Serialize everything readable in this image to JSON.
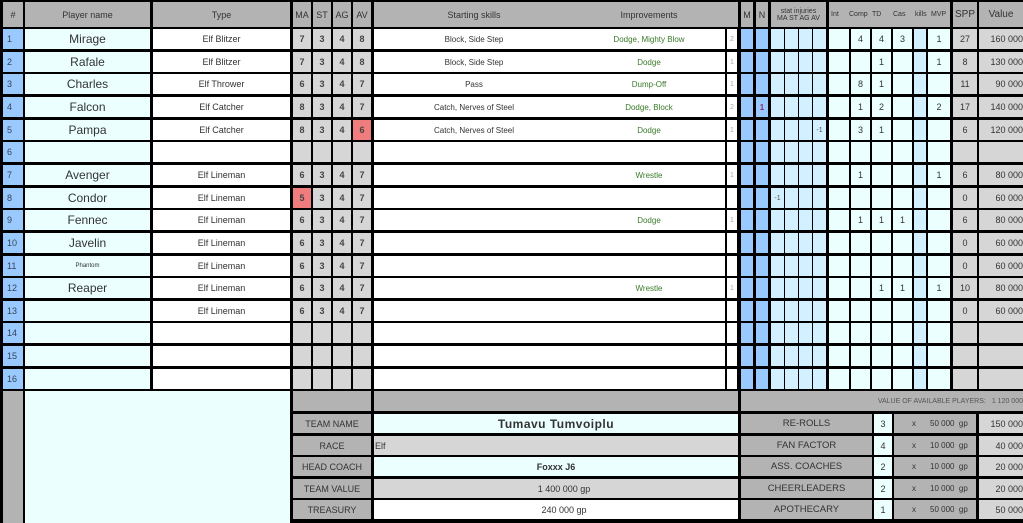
{
  "headers": {
    "num": "#",
    "player_name": "Player name",
    "type": "Type",
    "ma": "MA",
    "st": "ST",
    "ag": "AG",
    "av": "AV",
    "starting_skills": "Starting skills",
    "improvements": "Improvements",
    "m": "M",
    "n": "N",
    "stat_injuries_line1": "stat injuries",
    "stat_injuries_line2": "MA ST AG AV",
    "int": "Int",
    "comp": "Comp",
    "td": "TD",
    "cas": "Cas",
    "kills": "kills",
    "mvp": "MVP",
    "spp": "SPP",
    "value": "Value"
  },
  "players": [
    {
      "num": "1",
      "name": "Mirage",
      "type": "Elf Blitzer",
      "ma": "7",
      "st": "3",
      "ag": "4",
      "av": "8",
      "skills": "Block, Side Step",
      "improvements": "Dodge, Mighty Blow",
      "count": "2",
      "m": "",
      "n": "",
      "inj_ma": "",
      "inj_st": "",
      "inj_ag": "",
      "inj_av": "",
      "int": "",
      "comp": "4",
      "td": "4",
      "cas": "3",
      "kills": "",
      "mvp": "1",
      "spp": "27",
      "value": "160 000"
    },
    {
      "num": "2",
      "name": "Rafale",
      "type": "Elf Blitzer",
      "ma": "7",
      "st": "3",
      "ag": "4",
      "av": "8",
      "skills": "Block, Side Step",
      "improvements": "Dodge",
      "count": "1",
      "m": "",
      "n": "",
      "inj_ma": "",
      "inj_st": "",
      "inj_ag": "",
      "inj_av": "",
      "int": "",
      "comp": "",
      "td": "1",
      "cas": "",
      "kills": "",
      "mvp": "1",
      "spp": "8",
      "value": "130 000"
    },
    {
      "num": "3",
      "name": "Charles",
      "type": "Elf Thrower",
      "ma": "6",
      "st": "3",
      "ag": "4",
      "av": "7",
      "skills": "Pass",
      "improvements": "Dump-Off",
      "count": "1",
      "m": "",
      "n": "",
      "inj_ma": "",
      "inj_st": "",
      "inj_ag": "",
      "inj_av": "",
      "int": "",
      "comp": "8",
      "td": "1",
      "cas": "",
      "kills": "",
      "mvp": "",
      "spp": "11",
      "value": "90 000"
    },
    {
      "num": "4",
      "name": "Falcon",
      "type": "Elf Catcher",
      "ma": "8",
      "st": "3",
      "ag": "4",
      "av": "7",
      "skills": "Catch, Nerves of Steel",
      "improvements": "Dodge, Block",
      "count": "2",
      "m": "",
      "n": "1",
      "inj_ma": "",
      "inj_st": "",
      "inj_ag": "",
      "inj_av": "",
      "int": "",
      "comp": "1",
      "td": "2",
      "cas": "",
      "kills": "",
      "mvp": "2",
      "spp": "17",
      "value": "140 000"
    },
    {
      "num": "5",
      "name": "Pampa",
      "type": "Elf Catcher",
      "ma": "8",
      "st": "3",
      "ag": "4",
      "av": "6",
      "av_injured": true,
      "skills": "Catch, Nerves of Steel",
      "improvements": "Dodge",
      "count": "1",
      "m": "",
      "n": "",
      "inj_ma": "",
      "inj_st": "",
      "inj_ag": "",
      "inj_av": "-1",
      "int": "",
      "comp": "3",
      "td": "1",
      "cas": "",
      "kills": "",
      "mvp": "",
      "spp": "6",
      "value": "120 000"
    },
    {
      "num": "6",
      "name": "",
      "type": "",
      "ma": "",
      "st": "",
      "ag": "",
      "av": "",
      "skills": "",
      "improvements": "",
      "count": "",
      "m": "",
      "n": "",
      "inj_ma": "",
      "inj_st": "",
      "inj_ag": "",
      "inj_av": "",
      "int": "",
      "comp": "",
      "td": "",
      "cas": "",
      "kills": "",
      "mvp": "",
      "spp": "",
      "value": ""
    },
    {
      "num": "7",
      "name": "Avenger",
      "type": "Elf Lineman",
      "ma": "6",
      "st": "3",
      "ag": "4",
      "av": "7",
      "skills": "",
      "improvements": "Wrestle",
      "count": "1",
      "m": "",
      "n": "",
      "inj_ma": "",
      "inj_st": "",
      "inj_ag": "",
      "inj_av": "",
      "int": "",
      "comp": "1",
      "td": "",
      "cas": "",
      "kills": "",
      "mvp": "1",
      "spp": "6",
      "value": "80 000"
    },
    {
      "num": "8",
      "name": "Condor",
      "type": "Elf Lineman",
      "ma": "5",
      "ma_injured": true,
      "st": "3",
      "ag": "4",
      "av": "7",
      "skills": "",
      "improvements": "",
      "count": "",
      "m": "",
      "n": "",
      "inj_ma": "-1",
      "inj_st": "",
      "inj_ag": "",
      "inj_av": "",
      "int": "",
      "comp": "",
      "td": "",
      "cas": "",
      "kills": "",
      "mvp": "",
      "spp": "0",
      "value": "60 000"
    },
    {
      "num": "9",
      "name": "Fennec",
      "type": "Elf Lineman",
      "ma": "6",
      "st": "3",
      "ag": "4",
      "av": "7",
      "skills": "",
      "improvements": "Dodge",
      "count": "1",
      "m": "",
      "n": "",
      "inj_ma": "",
      "inj_st": "",
      "inj_ag": "",
      "inj_av": "",
      "int": "",
      "comp": "1",
      "td": "1",
      "cas": "1",
      "kills": "",
      "mvp": "",
      "spp": "6",
      "value": "80 000"
    },
    {
      "num": "10",
      "name": "Javelin",
      "type": "Elf Lineman",
      "ma": "6",
      "st": "3",
      "ag": "4",
      "av": "7",
      "skills": "",
      "improvements": "",
      "count": "",
      "m": "",
      "n": "",
      "inj_ma": "",
      "inj_st": "",
      "inj_ag": "",
      "inj_av": "",
      "int": "",
      "comp": "",
      "td": "",
      "cas": "",
      "kills": "",
      "mvp": "",
      "spp": "0",
      "value": "60 000"
    },
    {
      "num": "11",
      "name": "Phantom",
      "name_small": true,
      "type": "Elf Lineman",
      "ma": "6",
      "st": "3",
      "ag": "4",
      "av": "7",
      "skills": "",
      "improvements": "",
      "count": "",
      "m": "",
      "n": "",
      "inj_ma": "",
      "inj_st": "",
      "inj_ag": "",
      "inj_av": "",
      "int": "",
      "comp": "",
      "td": "",
      "cas": "",
      "kills": "",
      "mvp": "",
      "spp": "0",
      "value": "60 000"
    },
    {
      "num": "12",
      "name": "Reaper",
      "type": "Elf Lineman",
      "ma": "6",
      "st": "3",
      "ag": "4",
      "av": "7",
      "skills": "",
      "improvements": "Wrestle",
      "count": "1",
      "m": "",
      "n": "",
      "inj_ma": "",
      "inj_st": "",
      "inj_ag": "",
      "inj_av": "",
      "int": "",
      "comp": "",
      "td": "1",
      "cas": "1",
      "kills": "",
      "mvp": "1",
      "spp": "10",
      "value": "80 000"
    },
    {
      "num": "13",
      "name": "",
      "type": "Elf Lineman",
      "ma": "6",
      "st": "3",
      "ag": "4",
      "av": "7",
      "skills": "",
      "improvements": "",
      "count": "",
      "m": "",
      "n": "",
      "inj_ma": "",
      "inj_st": "",
      "inj_ag": "",
      "inj_av": "",
      "int": "",
      "comp": "",
      "td": "",
      "cas": "",
      "kills": "",
      "mvp": "",
      "spp": "0",
      "value": "60 000"
    },
    {
      "num": "14",
      "name": "",
      "type": "",
      "ma": "",
      "st": "",
      "ag": "",
      "av": "",
      "skills": "",
      "improvements": "",
      "count": "",
      "m": "",
      "n": "",
      "inj_ma": "",
      "inj_st": "",
      "inj_ag": "",
      "inj_av": "",
      "int": "",
      "comp": "",
      "td": "",
      "cas": "",
      "kills": "",
      "mvp": "",
      "spp": "",
      "value": ""
    },
    {
      "num": "15",
      "name": "",
      "type": "",
      "ma": "",
      "st": "",
      "ag": "",
      "av": "",
      "skills": "",
      "improvements": "",
      "count": "",
      "m": "",
      "n": "",
      "inj_ma": "",
      "inj_st": "",
      "inj_ag": "",
      "inj_av": "",
      "int": "",
      "comp": "",
      "td": "",
      "cas": "",
      "kills": "",
      "mvp": "",
      "spp": "",
      "value": ""
    },
    {
      "num": "16",
      "name": "",
      "type": "",
      "ma": "",
      "st": "",
      "ag": "",
      "av": "",
      "skills": "",
      "improvements": "",
      "count": "",
      "m": "",
      "n": "",
      "inj_ma": "",
      "inj_st": "",
      "inj_ag": "",
      "inj_av": "",
      "int": "",
      "comp": "",
      "td": "",
      "cas": "",
      "kills": "",
      "mvp": "",
      "spp": "",
      "value": ""
    }
  ],
  "team_info": {
    "team_name_label": "TEAM NAME",
    "team_name": "Tumavu Tumvoiplu",
    "race_label": "RACE",
    "race": "Elf",
    "head_coach_label": "HEAD COACH",
    "head_coach": "Foxxx J6",
    "team_value_label": "TEAM VALUE",
    "team_value": "1 400 000  gp",
    "treasury_label": "TREASURY",
    "treasury": "240 000  gp"
  },
  "available_players": {
    "label": "VALUE OF AVAILABLE PLAYERS:",
    "value": "1 120 000"
  },
  "extras": [
    {
      "label": "RE-ROLLS",
      "qty": "3",
      "x": "x",
      "unit": "50 000  gp",
      "total": "150 000"
    },
    {
      "label": "FAN FACTOR",
      "qty": "4",
      "x": "x",
      "unit": "10 000  gp",
      "total": "40 000"
    },
    {
      "label": "ASS. COACHES",
      "qty": "2",
      "x": "x",
      "unit": "10 000  gp",
      "total": "20 000"
    },
    {
      "label": "CHEERLEADERS",
      "qty": "2",
      "x": "x",
      "unit": "10 000  gp",
      "total": "20 000"
    },
    {
      "label": "APOTHECARY",
      "qty": "1",
      "x": "x",
      "unit": "50 000  gp",
      "total": "50 000"
    }
  ],
  "colors": {
    "header_gray": "#b3b3b3",
    "number_blue": "#99c9ff",
    "name_cyan": "#ebffff",
    "stat_gray": "#d6d6d6",
    "injured_red": "#f07d7d",
    "improvement_green": "#3a7a2a",
    "injury_blue": "#d2f0ff"
  }
}
